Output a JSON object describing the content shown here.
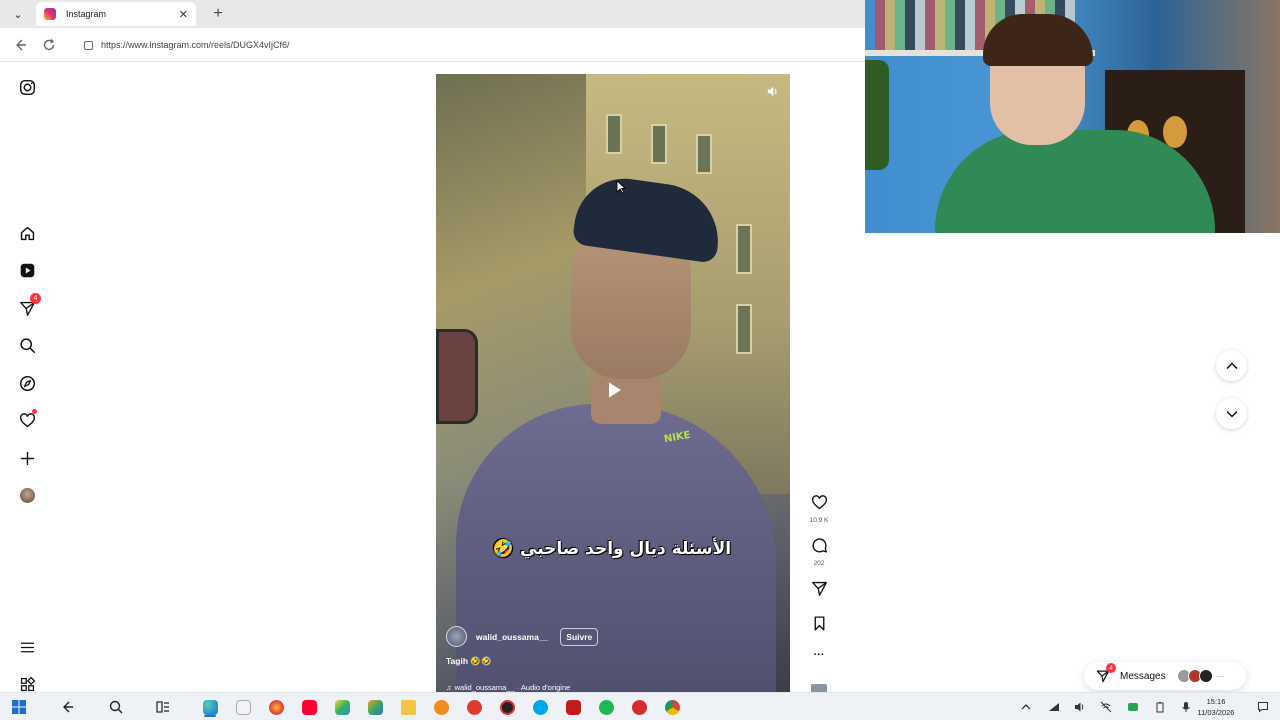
{
  "browser": {
    "tab": {
      "title": "Instagram",
      "close": "✕"
    },
    "new_tab": "+",
    "tab_list": "⌄",
    "url": "https://www.instagram.com/reels/DUGX4vIjCf6/"
  },
  "reel": {
    "overlay_caption": "الأسئلة ديال واحد صاحبي 🤣",
    "shirt_logo": "NIKE",
    "username": "walid_oussama__",
    "follow_label": "Suivre",
    "caption": "Tagih 🤣🤣",
    "audio": "walid_oussama__ · Audio d'origine"
  },
  "actions": {
    "likes": "10,9 K",
    "comments": "202",
    "more": "···"
  },
  "messages": {
    "label": "Messages",
    "badge": "4",
    "more": "···"
  },
  "rail": {
    "notifications_badge": "4"
  },
  "taskbar": {
    "time": "15:16",
    "date": "11/03/2026"
  },
  "colors": {
    "accent_red": "#ff3040",
    "instagram_gradient": [
      "#f9b332",
      "#e1306c",
      "#833ab4"
    ]
  },
  "icons": [
    "instagram-icon",
    "home-icon",
    "reels-icon",
    "messages-icon",
    "search-icon",
    "explore-icon",
    "heart-icon",
    "create-icon",
    "menu-icon",
    "apps-icon",
    "mute-icon",
    "play-icon",
    "comment-icon",
    "share-icon",
    "bookmark-icon",
    "chevron-up-icon",
    "chevron-down-icon"
  ]
}
